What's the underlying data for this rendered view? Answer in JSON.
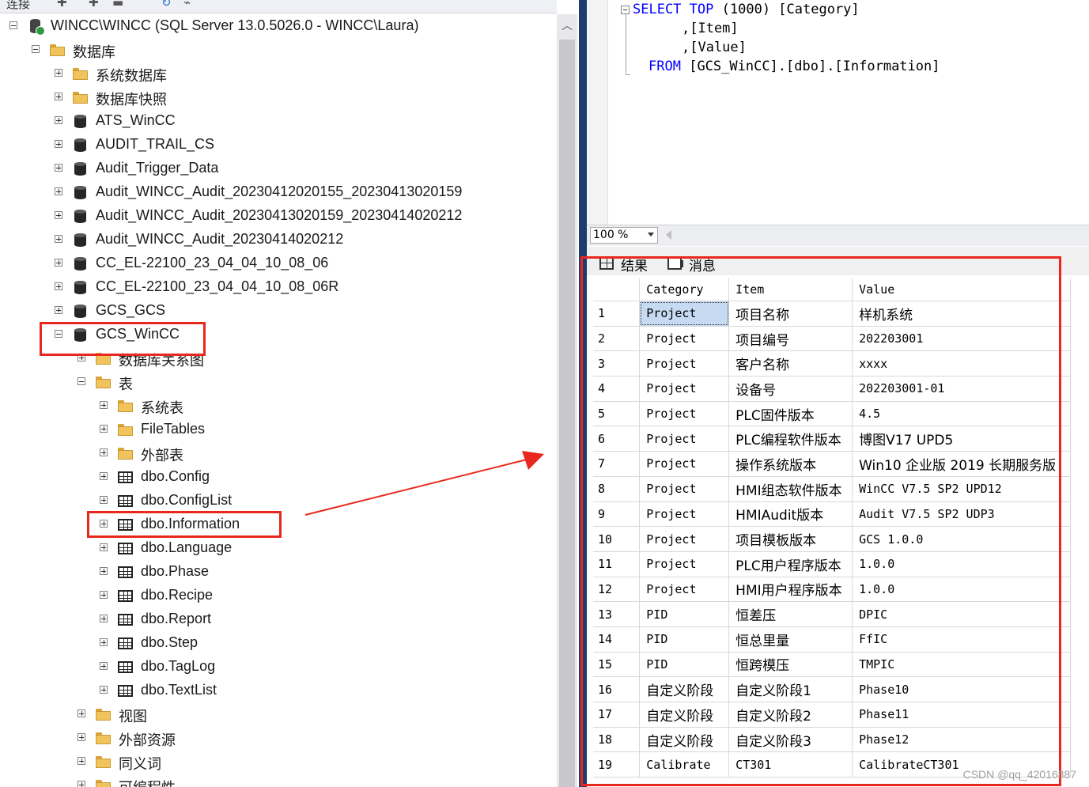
{
  "explorer": {
    "toolbar_label": "连接",
    "server_node": "WINCC\\WINCC (SQL Server 13.0.5026.0 - WINCC\\Laura)",
    "databases_folder": "数据库",
    "system_databases": "系统数据库",
    "database_snapshots": "数据库快照",
    "databases": [
      "ATS_WinCC",
      "AUDIT_TRAIL_CS",
      "Audit_Trigger_Data",
      "Audit_WINCC_Audit_20230412020155_20230413020159",
      "Audit_WINCC_Audit_20230413020159_20230414020212",
      "Audit_WINCC_Audit_20230414020212",
      "CC_EL-22100_23_04_04_10_08_06",
      "CC_EL-22100_23_04_04_10_08_06R",
      "GCS_GCS"
    ],
    "selected_database": "GCS_WinCC",
    "db_diagrams": "数据库关系图",
    "tables_folder": "表",
    "system_tables": "系统表",
    "file_tables": "FileTables",
    "external_tables": "外部表",
    "tables": [
      "dbo.Config",
      "dbo.ConfigList",
      "dbo.Information",
      "dbo.Language",
      "dbo.Phase",
      "dbo.Recipe",
      "dbo.Report",
      "dbo.Step",
      "dbo.TagLog",
      "dbo.TextList"
    ],
    "views_folder": "视图",
    "external_resources": "外部资源",
    "synonyms": "同义词",
    "programmability": "可编程性"
  },
  "query": {
    "line1_kw1": "SELECT",
    "line1_kw2": "TOP",
    "line1_rest": "(1000) [Category]",
    "line2": ",[Item]",
    "line3": ",[Value]",
    "line4_kw": "FROM",
    "line4_rest": "[GCS_WinCC].[dbo].[Information]"
  },
  "zoom": {
    "value": "100 %"
  },
  "result_tabs": {
    "results": "结果",
    "messages": "消息"
  },
  "results": {
    "columns": [
      "Category",
      "Item",
      "Value"
    ],
    "rows": [
      [
        "1",
        "Project",
        "项目名称",
        "样机系统"
      ],
      [
        "2",
        "Project",
        "项目编号",
        "202203001"
      ],
      [
        "3",
        "Project",
        "客户名称",
        "xxxx"
      ],
      [
        "4",
        "Project",
        "设备号",
        "202203001-01"
      ],
      [
        "5",
        "Project",
        "PLC固件版本",
        "4.5"
      ],
      [
        "6",
        "Project",
        "PLC编程软件版本",
        "博图V17 UPD5"
      ],
      [
        "7",
        "Project",
        "操作系统版本",
        "Win10 企业版 2019 长期服务版"
      ],
      [
        "8",
        "Project",
        "HMI组态软件版本",
        "WinCC V7.5 SP2 UPD12"
      ],
      [
        "9",
        "Project",
        "HMIAudit版本",
        "Audit V7.5 SP2 UDP3"
      ],
      [
        "10",
        "Project",
        "项目模板版本",
        "GCS 1.0.0"
      ],
      [
        "11",
        "Project",
        "PLC用户程序版本",
        "1.0.0"
      ],
      [
        "12",
        "Project",
        "HMI用户程序版本",
        "1.0.0"
      ],
      [
        "13",
        "PID",
        "恒差压",
        "DPIC"
      ],
      [
        "14",
        "PID",
        "恒总里量",
        "FfIC"
      ],
      [
        "15",
        "PID",
        "恒跨模压",
        "TMPIC"
      ],
      [
        "16",
        "自定义阶段",
        "自定义阶段1",
        "Phase10"
      ],
      [
        "17",
        "自定义阶段",
        "自定义阶段2",
        "Phase11"
      ],
      [
        "18",
        "自定义阶段",
        "自定义阶段3",
        "Phase12"
      ],
      [
        "19",
        "Calibrate",
        "CT301",
        "CalibrateCT301"
      ]
    ]
  },
  "watermark": "CSDN @qq_42016887",
  "colors": {
    "highlight": "#e8281e",
    "keyword": "#0000ff",
    "selected_cell": "#c6daf2"
  }
}
